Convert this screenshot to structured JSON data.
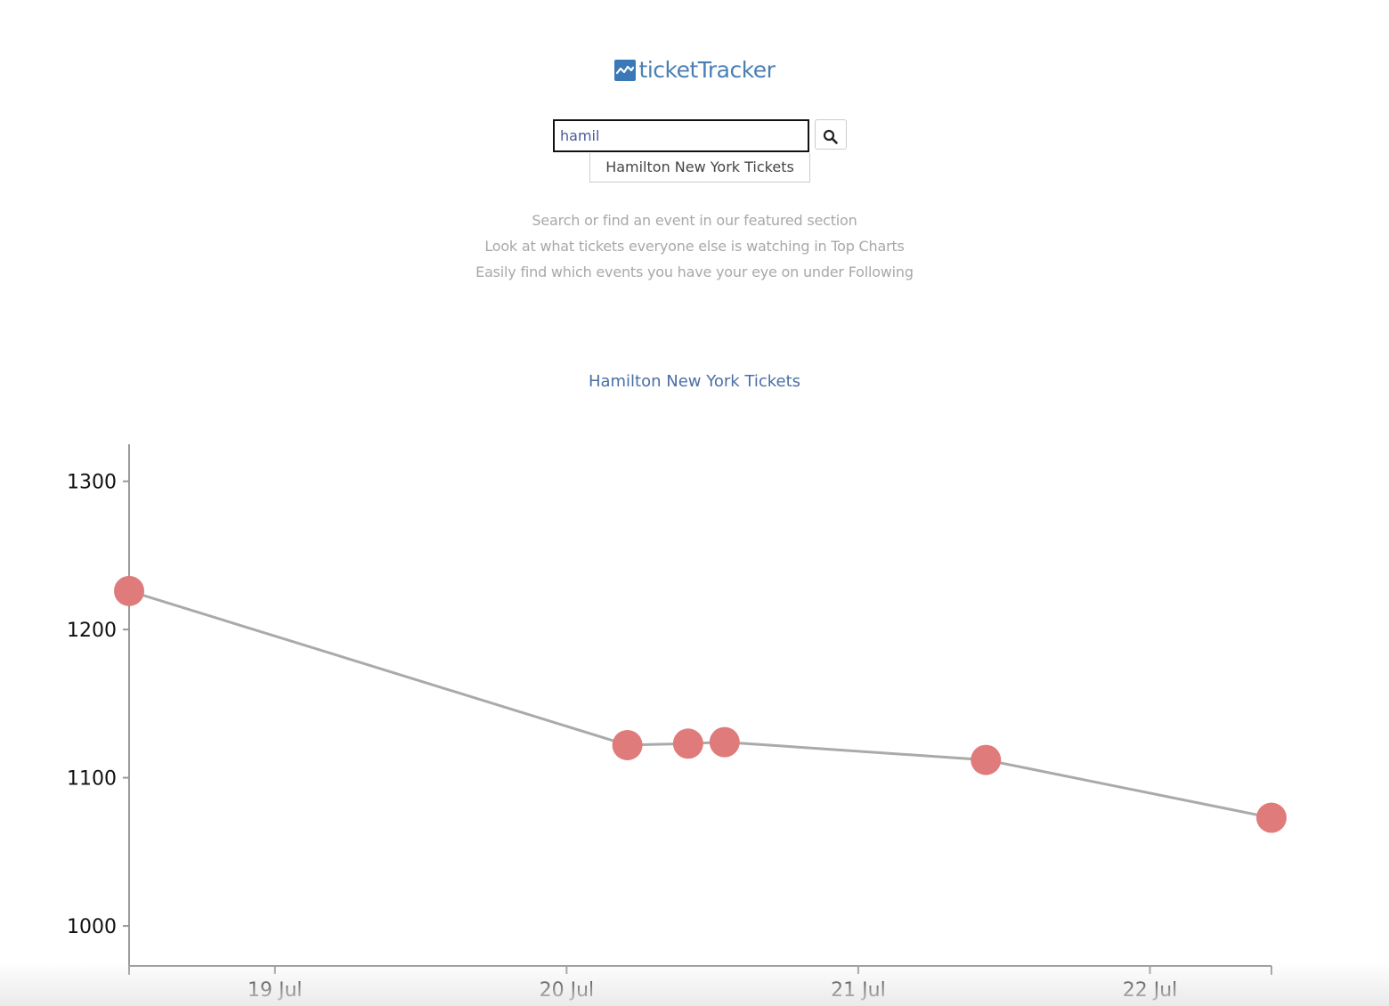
{
  "header": {
    "logo_text": "ticketTracker",
    "logo_icon": "line-chart-icon",
    "brand_color": "#4a7fb5"
  },
  "search": {
    "value": "hamil",
    "placeholder": "",
    "button_icon": "search-icon",
    "suggestions": [
      "Hamilton New York Tickets"
    ]
  },
  "info": {
    "lines": [
      "Search or find an event in our featured section",
      "Look at what tickets everyone else is watching in Top Charts",
      "Easily find which events you have your eye on under Following"
    ]
  },
  "chart_data": {
    "type": "line",
    "title": "Hamilton New York Tickets",
    "xlabel": "",
    "ylabel": "",
    "x_ticks": [
      "19 Jul",
      "20 Jul",
      "21 Jul",
      "22 Jul"
    ],
    "y_ticks": [
      1000,
      1100,
      1200,
      1300
    ],
    "xlim": [
      "2017-07-18T12:00",
      "2017-07-22T10:00"
    ],
    "ylim": [
      973,
      1325
    ],
    "grid": false,
    "line_color": "#aaaaaa",
    "point_color": "#e07b7b",
    "points": [
      {
        "x": "2017-07-18T12:00",
        "y": 1226
      },
      {
        "x": "2017-07-20T05:00",
        "y": 1122
      },
      {
        "x": "2017-07-20T10:00",
        "y": 1123
      },
      {
        "x": "2017-07-20T13:00",
        "y": 1124
      },
      {
        "x": "2017-07-21T10:30",
        "y": 1112
      },
      {
        "x": "2017-07-22T10:00",
        "y": 1073
      }
    ]
  }
}
